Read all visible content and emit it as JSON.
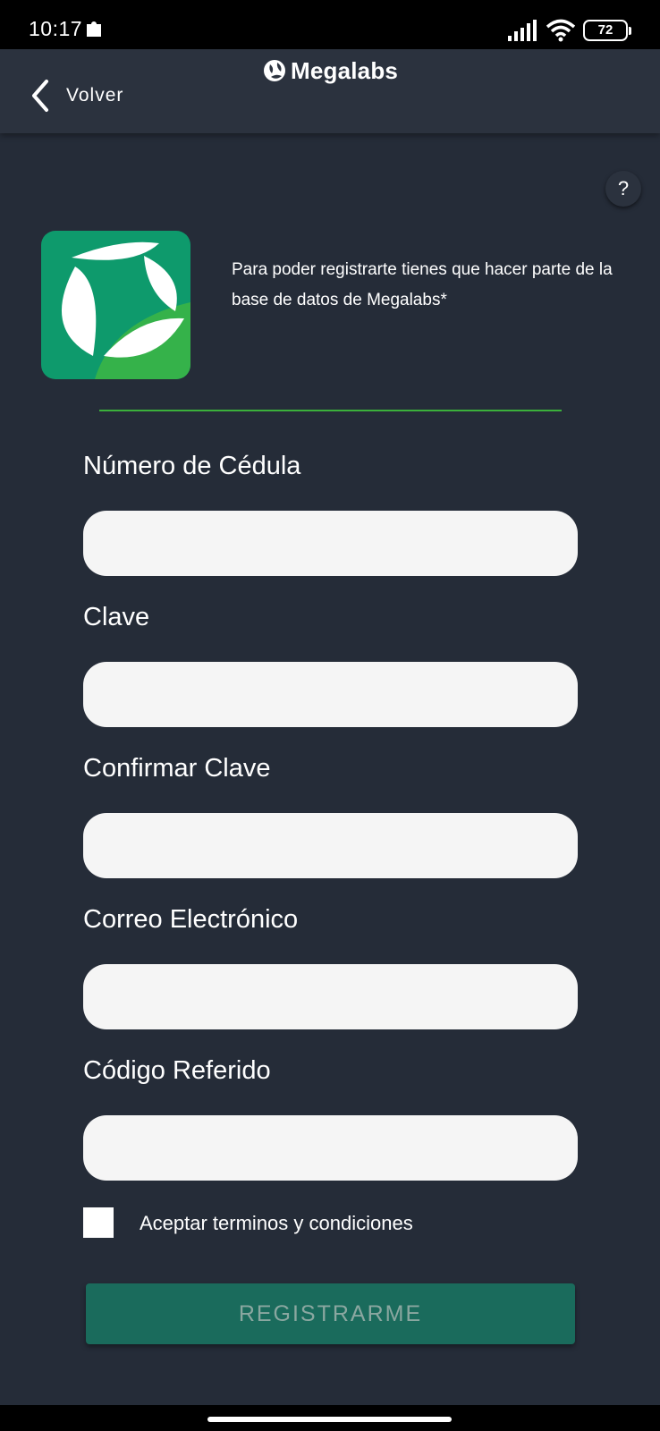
{
  "status_bar": {
    "time": "10:17",
    "battery": "72",
    "notification_icon": "puzzle-icon",
    "signal_icon": "signal-icon",
    "wifi_icon": "wifi-icon"
  },
  "header": {
    "back_label": "Volver",
    "brand_name": "Megalabs",
    "brand_icon": "megalabs-logo-icon"
  },
  "help_label": "?",
  "intro_text": "Para poder registrarte tienes que hacer parte de la base de datos de Megalabs*",
  "form": {
    "fields": [
      {
        "label": "Número de Cédula",
        "value": ""
      },
      {
        "label": "Clave",
        "value": ""
      },
      {
        "label": "Confirmar Clave",
        "value": ""
      },
      {
        "label": "Correo Electrónico",
        "value": ""
      },
      {
        "label": "Código Referido",
        "value": ""
      }
    ],
    "terms_label": "Aceptar terminos y condiciones",
    "terms_checked": false,
    "submit_label": "REGISTRARME"
  },
  "colors": {
    "background": "#252c38",
    "header": "#2b323e",
    "accent_green": "#3bb03b",
    "button": "#1a6b5c",
    "button_text": "#8aa7a0"
  }
}
